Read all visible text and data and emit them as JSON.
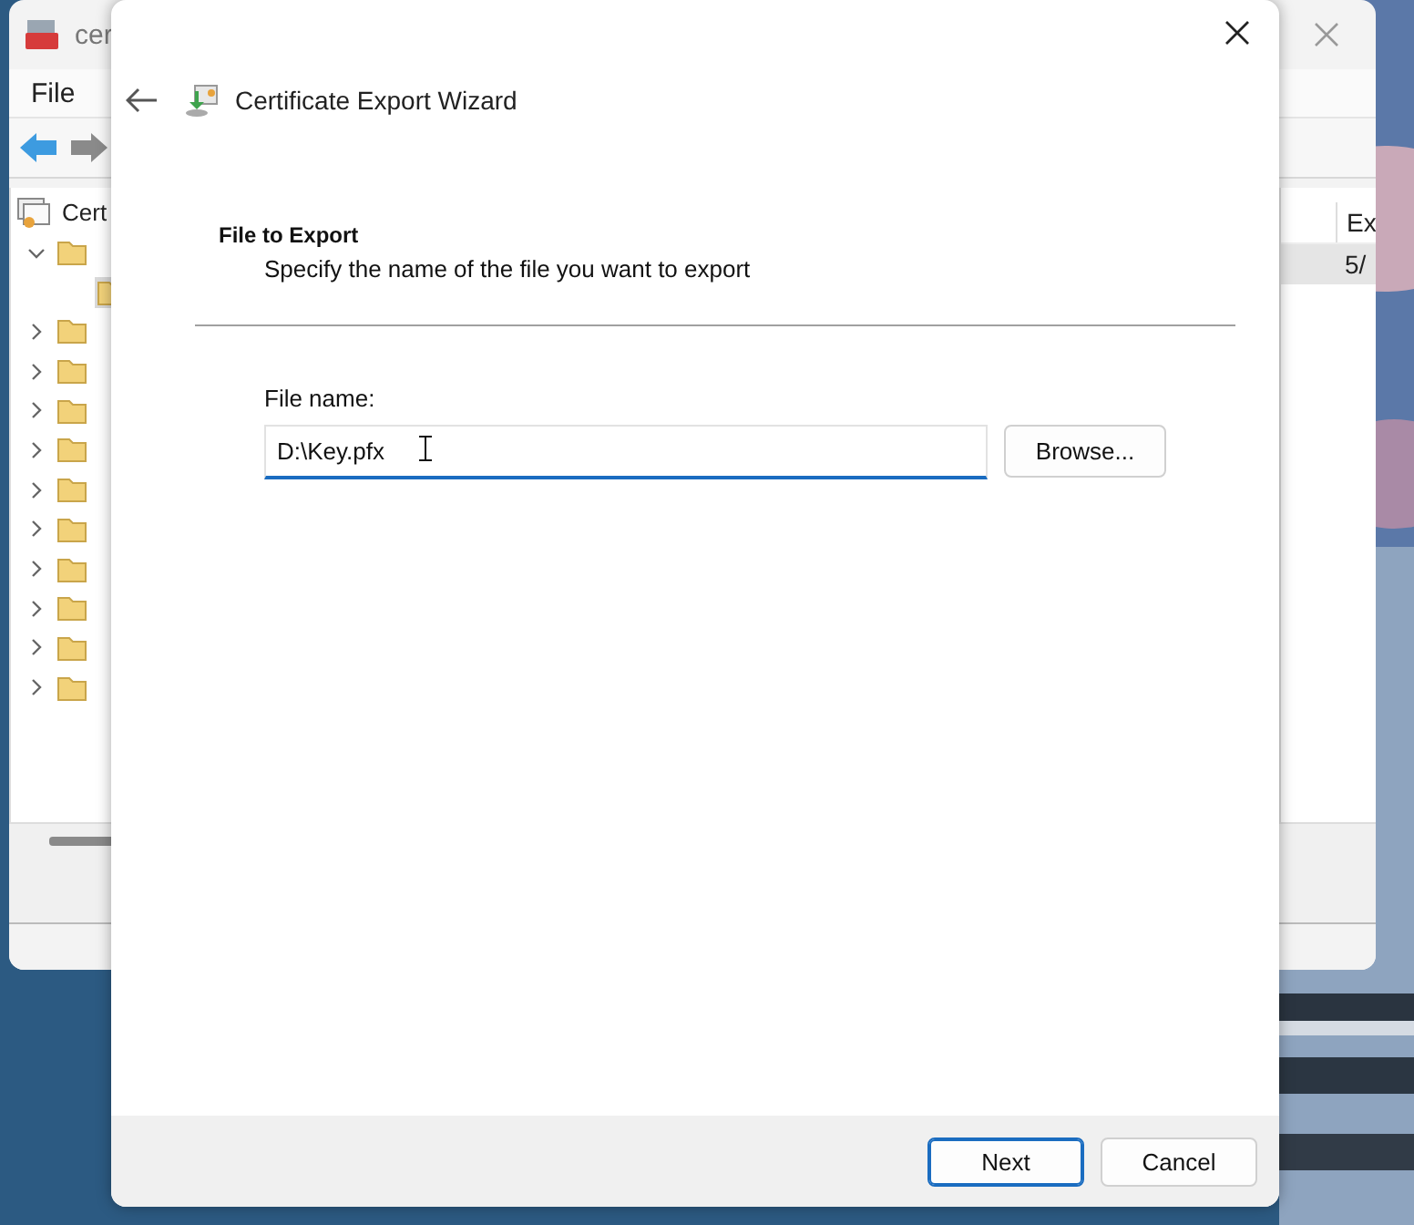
{
  "background_window": {
    "title": "cer",
    "menu": [
      "File"
    ],
    "tree": {
      "root": "Cert",
      "items": [
        {
          "expanded": true,
          "children": [
            {
              "selected": true
            }
          ]
        },
        {
          "expanded": false
        },
        {
          "expanded": false
        },
        {
          "expanded": false
        },
        {
          "expanded": false
        },
        {
          "expanded": false
        },
        {
          "expanded": false
        },
        {
          "expanded": false
        },
        {
          "expanded": false
        },
        {
          "expanded": false
        },
        {
          "expanded": false
        }
      ]
    },
    "list": {
      "column_1": "Ex",
      "rows": [
        {
          "column_1": "5/",
          "selected": true
        }
      ]
    }
  },
  "dialog": {
    "title": "Certificate Export Wizard",
    "heading": "File to Export",
    "subheading": "Specify the name of the file you want to export",
    "file_name_label": "File name:",
    "file_name_value": "D:\\Key.pfx",
    "browse_button": "Browse...",
    "buttons": [
      {
        "label": "Next",
        "default": true
      },
      {
        "label": "Cancel",
        "default": false
      }
    ]
  }
}
